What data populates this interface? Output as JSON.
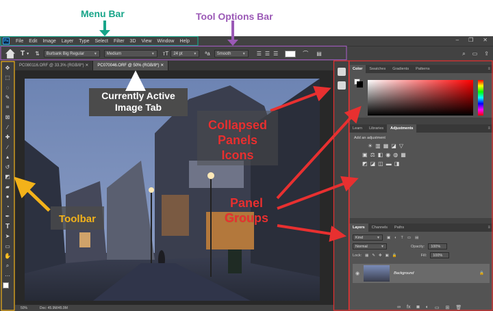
{
  "annotations": {
    "menu_bar": "Menu Bar",
    "tool_options_bar": "Tool Options Bar",
    "currently_active_image_tab": [
      "Currently Active",
      "Image Tab"
    ],
    "collapsed_panels_icons": [
      "Collapsed",
      "Panels",
      "Icons"
    ],
    "panel_groups": [
      "Panel",
      "Groups"
    ],
    "toolbar": "Toolbar",
    "colors": {
      "menu_bar": "#17a589",
      "tool_options": "#9b59b6",
      "red": "#e83030",
      "yellow": "#f3b21a"
    }
  },
  "menubar": {
    "app_icon": "Ps",
    "items": [
      "File",
      "Edit",
      "Image",
      "Layer",
      "Type",
      "Select",
      "Filter",
      "3D",
      "View",
      "Window",
      "Help"
    ]
  },
  "options_bar": {
    "font_family": "Burbank Big Regular",
    "font_style": "Medium",
    "font_size": "24 pt",
    "aa_label": "a",
    "anti_alias": "Smooth"
  },
  "document_tabs": [
    {
      "label": "PC080116.ORF @ 33.3% (RGB/8*)",
      "active": false
    },
    {
      "label": "PC070046.ORF @ 50% (RGB/8*)",
      "active": true
    }
  ],
  "status_bar": {
    "zoom": "50%",
    "doc": "Doc: 45.9M/45.9M"
  },
  "color_panel": {
    "tabs": [
      "Color",
      "Swatches",
      "Gradients",
      "Patterns"
    ],
    "active": "Color"
  },
  "adjust_panel": {
    "tabs": [
      "Learn",
      "Libraries",
      "Adjustments"
    ],
    "active": "Adjustments",
    "hint": "Add an adjustment"
  },
  "layers_panel": {
    "tabs": [
      "Layers",
      "Channels",
      "Paths"
    ],
    "active": "Layers",
    "kind": "Kind",
    "blend": "Normal",
    "opacity_label": "Opacity:",
    "opacity": "100%",
    "lock_label": "Lock:",
    "fill_label": "Fill:",
    "fill": "100%",
    "layer_name": "Background"
  }
}
